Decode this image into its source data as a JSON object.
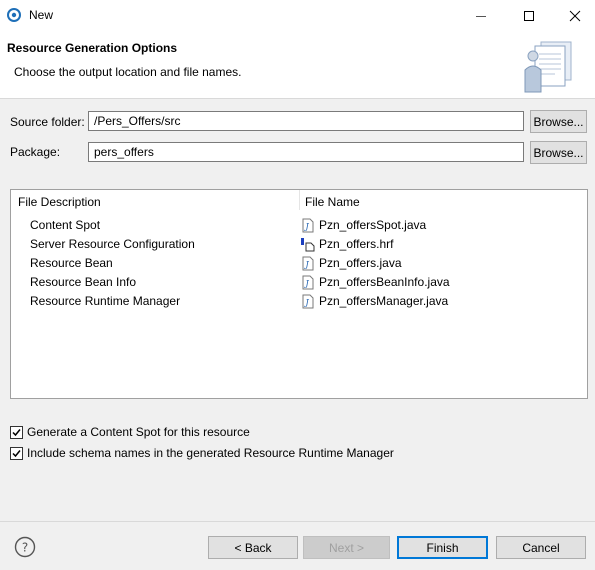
{
  "window": {
    "title": "New",
    "minimize_icon": "minimize-icon",
    "maximize_icon": "maximize-icon",
    "close_icon": "close-icon"
  },
  "header": {
    "title": "Resource Generation Options",
    "description": "Choose the output location and file names.",
    "graphic": "wizard-banner-icon"
  },
  "form": {
    "source_folder_label": "Source folder:",
    "source_folder_value": "/Pers_Offers/src",
    "package_label": "Package:",
    "package_value": "pers_offers",
    "browse_label": "Browse..."
  },
  "table": {
    "columns": [
      "File Description",
      "File Name"
    ],
    "rows": [
      {
        "description": "Content Spot",
        "file": "Pzn_offersSpot.java",
        "icon": "java-file-icon"
      },
      {
        "description": "Server Resource Configuration",
        "file": "Pzn_offers.hrf",
        "icon": "hrf-file-icon"
      },
      {
        "description": "Resource Bean",
        "file": "Pzn_offers.java",
        "icon": "java-file-icon"
      },
      {
        "description": "Resource Bean Info",
        "file": "Pzn_offersBeanInfo.java",
        "icon": "java-file-icon"
      },
      {
        "description": "Resource Runtime Manager",
        "file": "Pzn_offersManager.java",
        "icon": "java-file-icon"
      }
    ]
  },
  "options": {
    "generate_content_spot": {
      "label": "Generate a Content Spot for this resource",
      "checked": true
    },
    "include_schema_names": {
      "label": "Include schema names in the generated Resource Runtime Manager",
      "checked": true
    }
  },
  "footer": {
    "help_icon": "help-icon",
    "back_label": "< Back",
    "next_label": "Next >",
    "finish_label": "Finish",
    "cancel_label": "Cancel"
  }
}
